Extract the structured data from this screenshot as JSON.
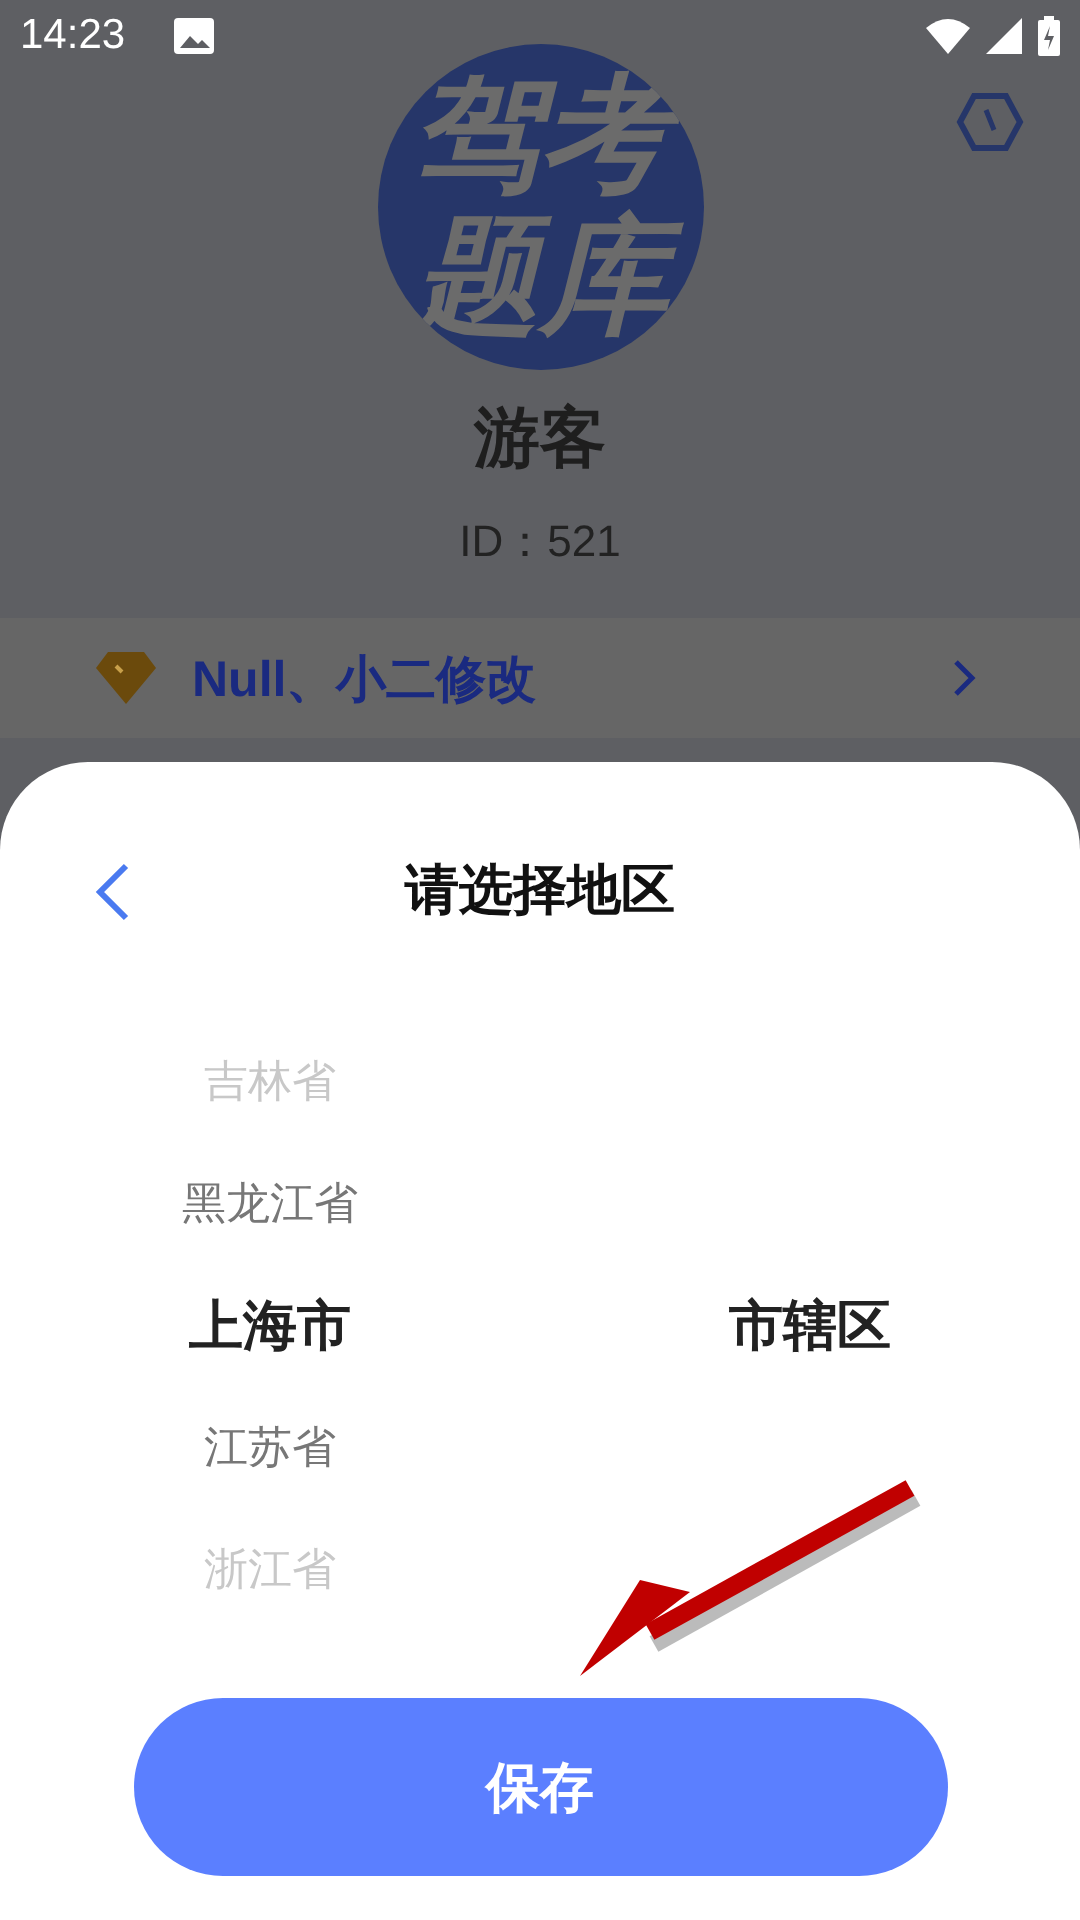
{
  "status_bar": {
    "time": "14:23"
  },
  "profile": {
    "logo_text": "驾考题库",
    "name": "游客",
    "id": "ID：521"
  },
  "vip": {
    "label": "Null、小二修改"
  },
  "sheet": {
    "title": "请选择地区",
    "columns": [
      {
        "items": [
          {
            "label": "吉林省",
            "selected": false
          },
          {
            "label": "黑龙江省",
            "selected": false
          },
          {
            "label": "上海市",
            "selected": true
          },
          {
            "label": "江苏省",
            "selected": false
          },
          {
            "label": "浙江省",
            "selected": false
          }
        ]
      },
      {
        "items": [
          {
            "label": "市辖区",
            "selected": true
          }
        ]
      }
    ]
  },
  "save_button": {
    "label": "保存"
  }
}
